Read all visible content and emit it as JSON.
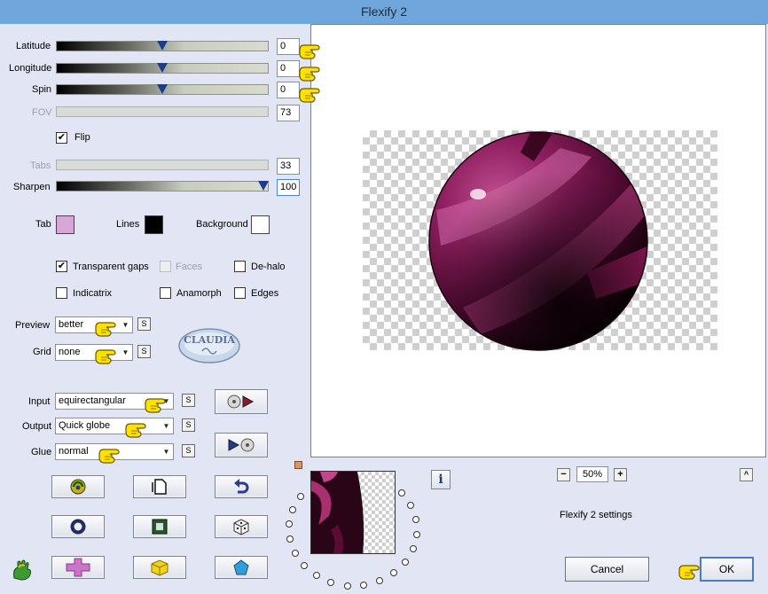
{
  "window": {
    "title": "Flexify 2"
  },
  "sliders": {
    "latitude": {
      "label": "Latitude",
      "value": "0",
      "level": 0.5
    },
    "longitude": {
      "label": "Longitude",
      "value": "0",
      "level": 0.5
    },
    "spin": {
      "label": "Spin",
      "value": "0",
      "level": 0.5
    },
    "fov": {
      "label": "FOV",
      "value": "73"
    },
    "tabs": {
      "label": "Tabs",
      "value": "33"
    },
    "sharpen": {
      "label": "Sharpen",
      "value": "100",
      "level": 1.0
    }
  },
  "flip": {
    "label": "Flip",
    "checked": true
  },
  "colors": {
    "tab": {
      "label": "Tab",
      "value": "#d9a6d8"
    },
    "lines": {
      "label": "Lines",
      "value": "#000000"
    },
    "background": {
      "label": "Background",
      "value": "#ffffff"
    }
  },
  "options": {
    "transparent_gaps": {
      "label": "Transparent gaps",
      "checked": true
    },
    "faces": {
      "label": "Faces",
      "checked": false
    },
    "de_halo": {
      "label": "De-halo",
      "checked": false
    },
    "indicatrix": {
      "label": "Indicatrix",
      "checked": false
    },
    "anamorph": {
      "label": "Anamorph",
      "checked": false
    },
    "edges": {
      "label": "Edges",
      "checked": false
    }
  },
  "dropdowns": {
    "preview": {
      "label": "Preview",
      "value": "better"
    },
    "grid": {
      "label": "Grid",
      "value": "none"
    },
    "input": {
      "label": "Input",
      "value": "equirectangular"
    },
    "output": {
      "label": "Output",
      "value": "Quick globe"
    },
    "glue": {
      "label": "Glue",
      "value": "normal"
    }
  },
  "s_button_label": "S",
  "logo_text": "CLAUDIA",
  "zoom": {
    "minus": "−",
    "value": "50%",
    "plus": "+"
  },
  "collapse_button": "^",
  "info_button": "i",
  "status_text": "Flexify 2 settings",
  "buttons": {
    "cancel": "Cancel",
    "ok": "OK"
  },
  "icons": {
    "tool_row1": [
      "randomize-icon",
      "new-document-icon",
      "undo-icon"
    ],
    "tool_row2": [
      "ring-icon",
      "square-frame-icon",
      "dice-icon"
    ],
    "tool_row3": [
      "cross-shape-icon",
      "cube-icon",
      "pentagon-icon"
    ]
  },
  "accent_colors": {
    "selection": "#6fa6dc",
    "sphere": "#6b1247"
  }
}
